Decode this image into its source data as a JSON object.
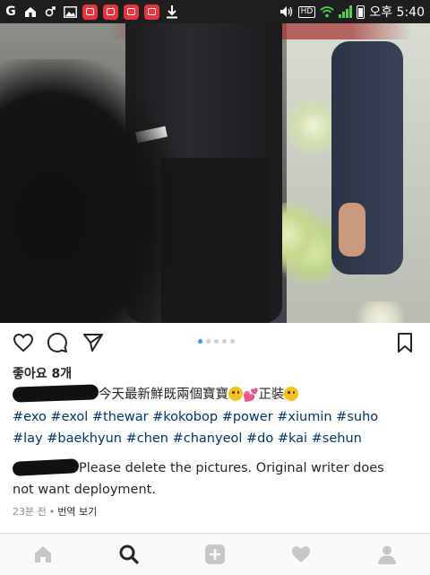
{
  "status_bar": {
    "left_icons": [
      "g-icon",
      "home-icon",
      "gender-icon",
      "image-icon",
      "app-icon",
      "app-icon",
      "app-icon",
      "app-icon",
      "download-icon"
    ],
    "hd_label": "HD",
    "time": "오후 5:40",
    "colors": {
      "background": "#1e1e1e",
      "signal": "#4ed04e",
      "app_badge": "#e8343f"
    }
  },
  "post": {
    "image_alt": "Photo of people in dark suits standing beside flower arrangements",
    "carousel": {
      "count": 5,
      "active_index": 0,
      "active_color": "#3897f0"
    },
    "likes_text": "좋아요 8개",
    "caption": {
      "text": "今天最新鮮既兩個寶寶",
      "suffix_text": "正裝",
      "hashtags_line1": "#exo #exol #thewar #kokobop #power #xiumin #suho",
      "hashtags_line2": "#lay #baekhyun #chen #chanyeol #do #kai #sehun"
    },
    "comment": {
      "text_line1": "Please delete the pictures. Original writer does",
      "text_line2": "not want deployment."
    },
    "timestamp": "23분 전",
    "separator": "•",
    "translate_label": "번역 보기"
  },
  "actions": {
    "icons": [
      "heart-icon",
      "comment-icon",
      "share-icon",
      "bookmark-icon"
    ]
  },
  "bottom_nav": {
    "items": [
      "home-icon",
      "search-icon",
      "add-post-icon",
      "activity-icon",
      "profile-icon"
    ],
    "active": "search-icon"
  }
}
